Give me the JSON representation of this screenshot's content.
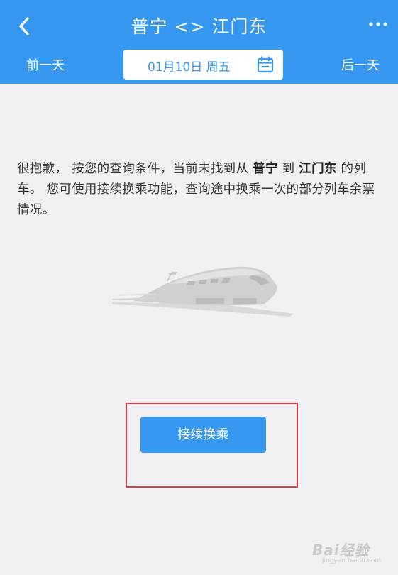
{
  "header": {
    "title": "普宁 <> 江门东",
    "prev_day": "前一天",
    "next_day": "后一天",
    "date": "01月10日 周五"
  },
  "message": {
    "part1": "很抱歉， 按您的查询条件，当前未找到从 ",
    "from_station": "普宁",
    "part2": " 到 ",
    "to_station": "江门东",
    "part3": " 的列车。 您可使用接续换乘功能，查询途中换乘一次的部分列车余票情况。"
  },
  "transfer_button_label": "接续换乘",
  "watermark": {
    "text": "Bai经验",
    "sub": "jingyan.baidu.com"
  },
  "colors": {
    "primary": "#3597f0",
    "background": "#f0eff4",
    "highlight": "#e23a3a"
  }
}
